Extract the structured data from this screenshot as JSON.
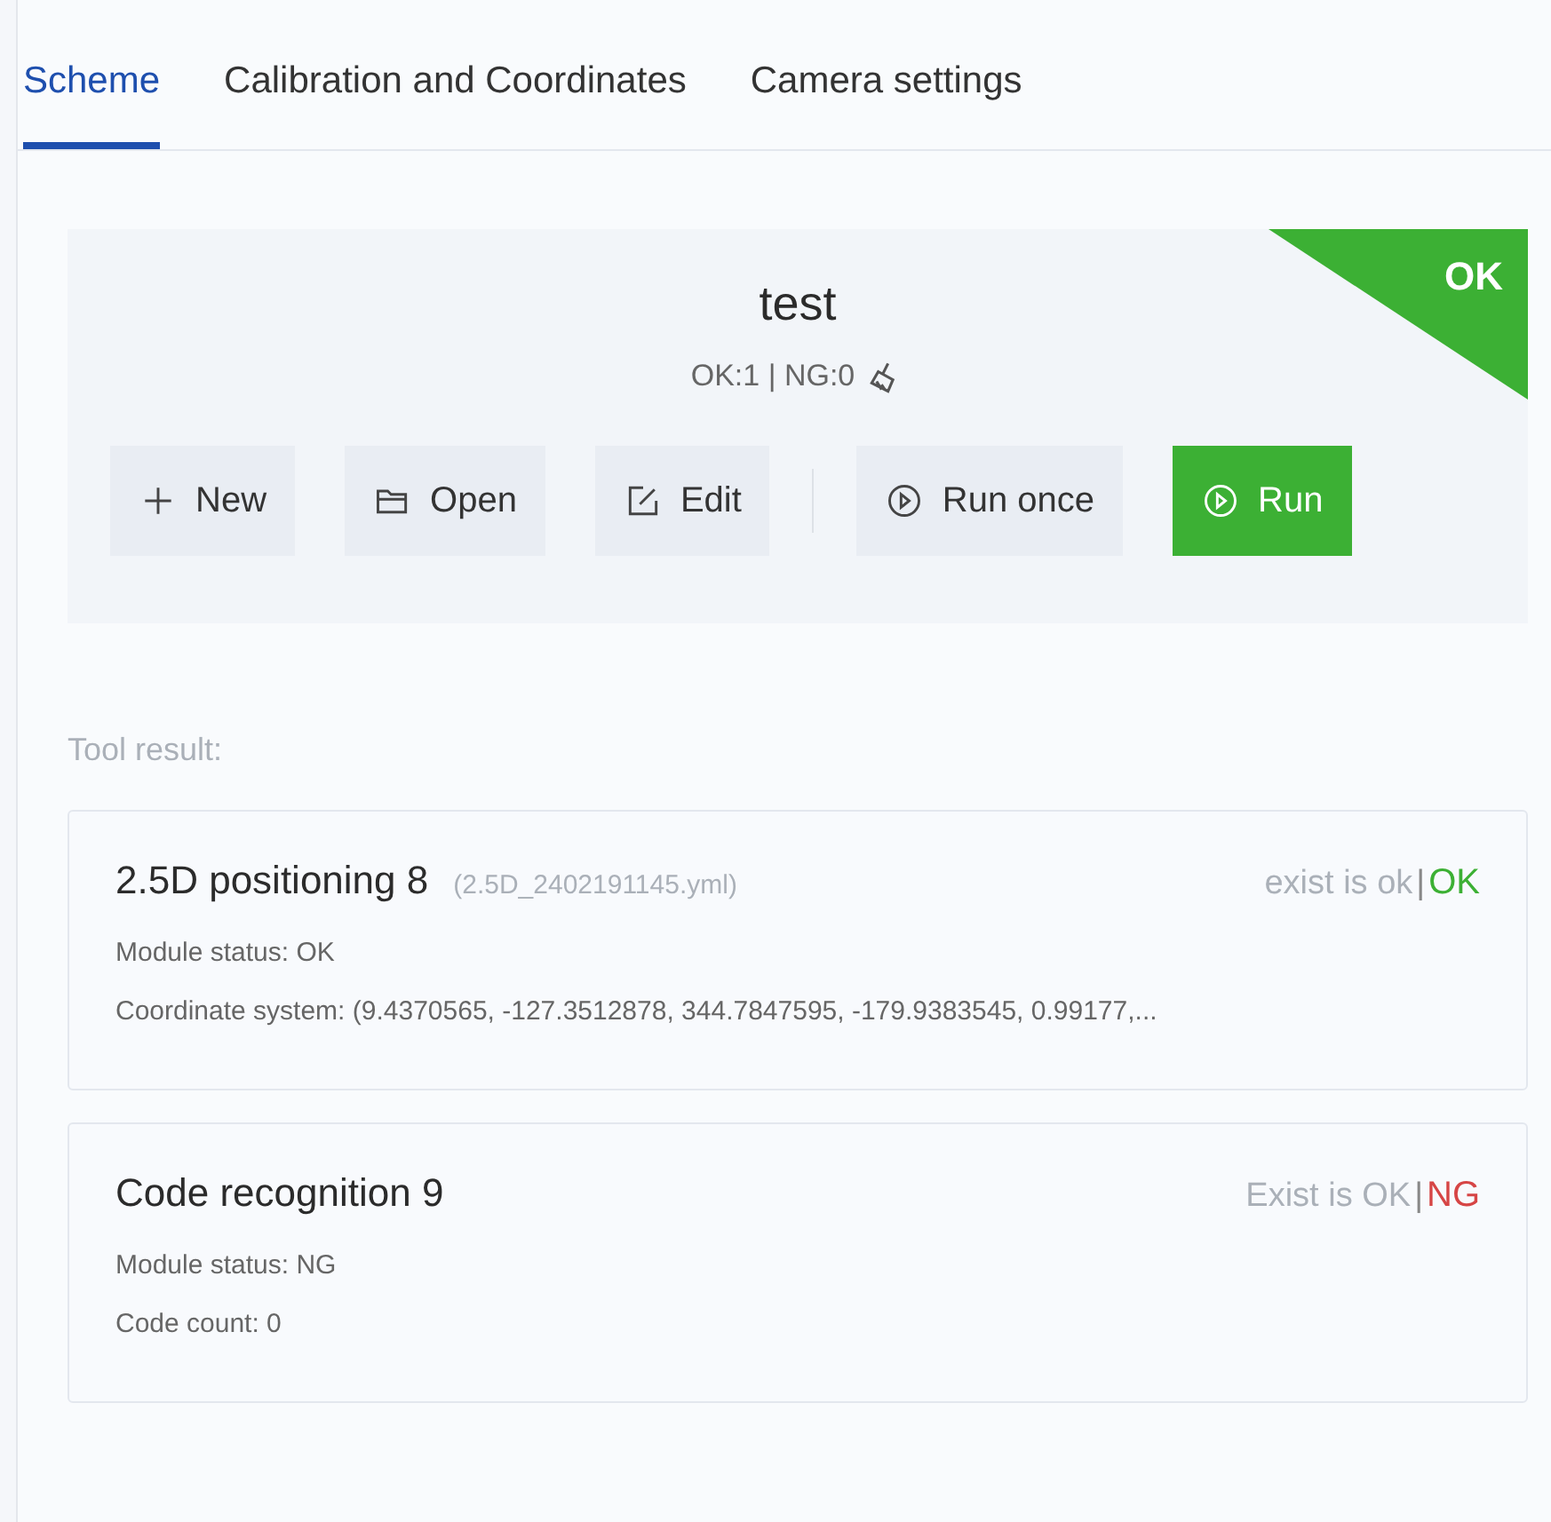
{
  "tabs": [
    {
      "label": "Scheme",
      "selected": true
    },
    {
      "label": "Calibration and Coordinates",
      "selected": false
    },
    {
      "label": "Camera settings",
      "selected": false
    }
  ],
  "scheme": {
    "name": "test",
    "counts": "OK:1 | NG:0",
    "badge": {
      "text": "OK",
      "color": "#3cb034"
    },
    "left_buttons": [
      {
        "label": "New",
        "kind": "new",
        "primary": false
      },
      {
        "label": "Open",
        "kind": "open",
        "primary": false
      },
      {
        "label": "Edit",
        "kind": "edit",
        "primary": false
      }
    ],
    "right_buttons": [
      {
        "label": "Run once",
        "kind": "run",
        "primary": false
      },
      {
        "label": "Run",
        "kind": "run",
        "primary": true
      }
    ]
  },
  "tool_result_label": "Tool result:",
  "results": [
    {
      "title": "2.5D positioning 8",
      "file": "(2.5D_2402191145.yml)",
      "check": "exist is ok",
      "separator": "|",
      "verdict": "OK",
      "color": "#3cb034",
      "lines": [
        "Module status: OK",
        "Coordinate system: (9.4370565, -127.3512878, 344.7847595, -179.9383545, 0.99177,..."
      ]
    },
    {
      "title": "Code recognition 9",
      "check": "Exist is OK",
      "separator": "|",
      "verdict": "NG",
      "color": "#d64545",
      "lines": [
        "Module status: NG",
        "Code count: 0"
      ]
    }
  ]
}
